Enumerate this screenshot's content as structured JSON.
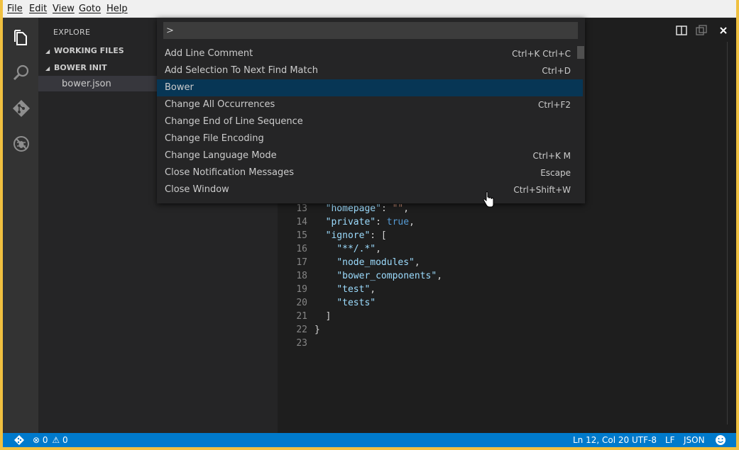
{
  "menu": [
    "File",
    "Edit",
    "View",
    "Goto",
    "Help"
  ],
  "activity_icons": [
    "files-icon",
    "search-icon",
    "git-icon",
    "debug-icon"
  ],
  "sidebar": {
    "title": "EXPLORE",
    "working_files": "WORKING FILES",
    "project": "BOWER INIT",
    "file": "bower.json"
  },
  "palette": {
    "input_value": ">",
    "items": [
      {
        "label": "Add Line Comment",
        "key": "Ctrl+K Ctrl+C"
      },
      {
        "label": "Add Selection To Next Find Match",
        "key": "Ctrl+D"
      },
      {
        "label": "Bower",
        "key": ""
      },
      {
        "label": "Change All Occurrences",
        "key": "Ctrl+F2"
      },
      {
        "label": "Change End of Line Sequence",
        "key": ""
      },
      {
        "label": "Change File Encoding",
        "key": ""
      },
      {
        "label": "Change Language Mode",
        "key": "Ctrl+K M"
      },
      {
        "label": "Close Notification Messages",
        "key": "Escape"
      },
      {
        "label": "Close Window",
        "key": "Ctrl+Shift+W"
      }
    ],
    "selected_index": 2
  },
  "code_lines": [
    {
      "n": "13",
      "indent": "  ",
      "parts": [
        [
          "k",
          "\"homepage\""
        ],
        [
          "p",
          ": "
        ],
        [
          "s",
          "\"\""
        ],
        [
          "p",
          ","
        ]
      ]
    },
    {
      "n": "14",
      "indent": "  ",
      "parts": [
        [
          "k",
          "\"private\""
        ],
        [
          "p",
          ": "
        ],
        [
          "b",
          "true"
        ],
        [
          "p",
          ","
        ]
      ]
    },
    {
      "n": "15",
      "indent": "  ",
      "parts": [
        [
          "k",
          "\"ignore\""
        ],
        [
          "p",
          ": ["
        ]
      ]
    },
    {
      "n": "16",
      "indent": "    ",
      "parts": [
        [
          "k",
          "\"**/.*\""
        ],
        [
          "p",
          ","
        ]
      ]
    },
    {
      "n": "17",
      "indent": "    ",
      "parts": [
        [
          "k",
          "\"node_modules\""
        ],
        [
          "p",
          ","
        ]
      ]
    },
    {
      "n": "18",
      "indent": "    ",
      "parts": [
        [
          "k",
          "\"bower_components\""
        ],
        [
          "p",
          ","
        ]
      ]
    },
    {
      "n": "19",
      "indent": "    ",
      "parts": [
        [
          "k",
          "\"test\""
        ],
        [
          "p",
          ","
        ]
      ]
    },
    {
      "n": "20",
      "indent": "    ",
      "parts": [
        [
          "k",
          "\"tests\""
        ]
      ]
    },
    {
      "n": "21",
      "indent": "  ",
      "parts": [
        [
          "p",
          "]"
        ]
      ]
    },
    {
      "n": "22",
      "indent": "",
      "parts": [
        [
          "p",
          "}"
        ]
      ]
    },
    {
      "n": "23",
      "indent": "",
      "parts": []
    }
  ],
  "status": {
    "errors": "0",
    "warnings": "0",
    "position": "Ln 12, Col 20",
    "encoding": "UTF-8",
    "eol": "LF",
    "language": "JSON"
  }
}
